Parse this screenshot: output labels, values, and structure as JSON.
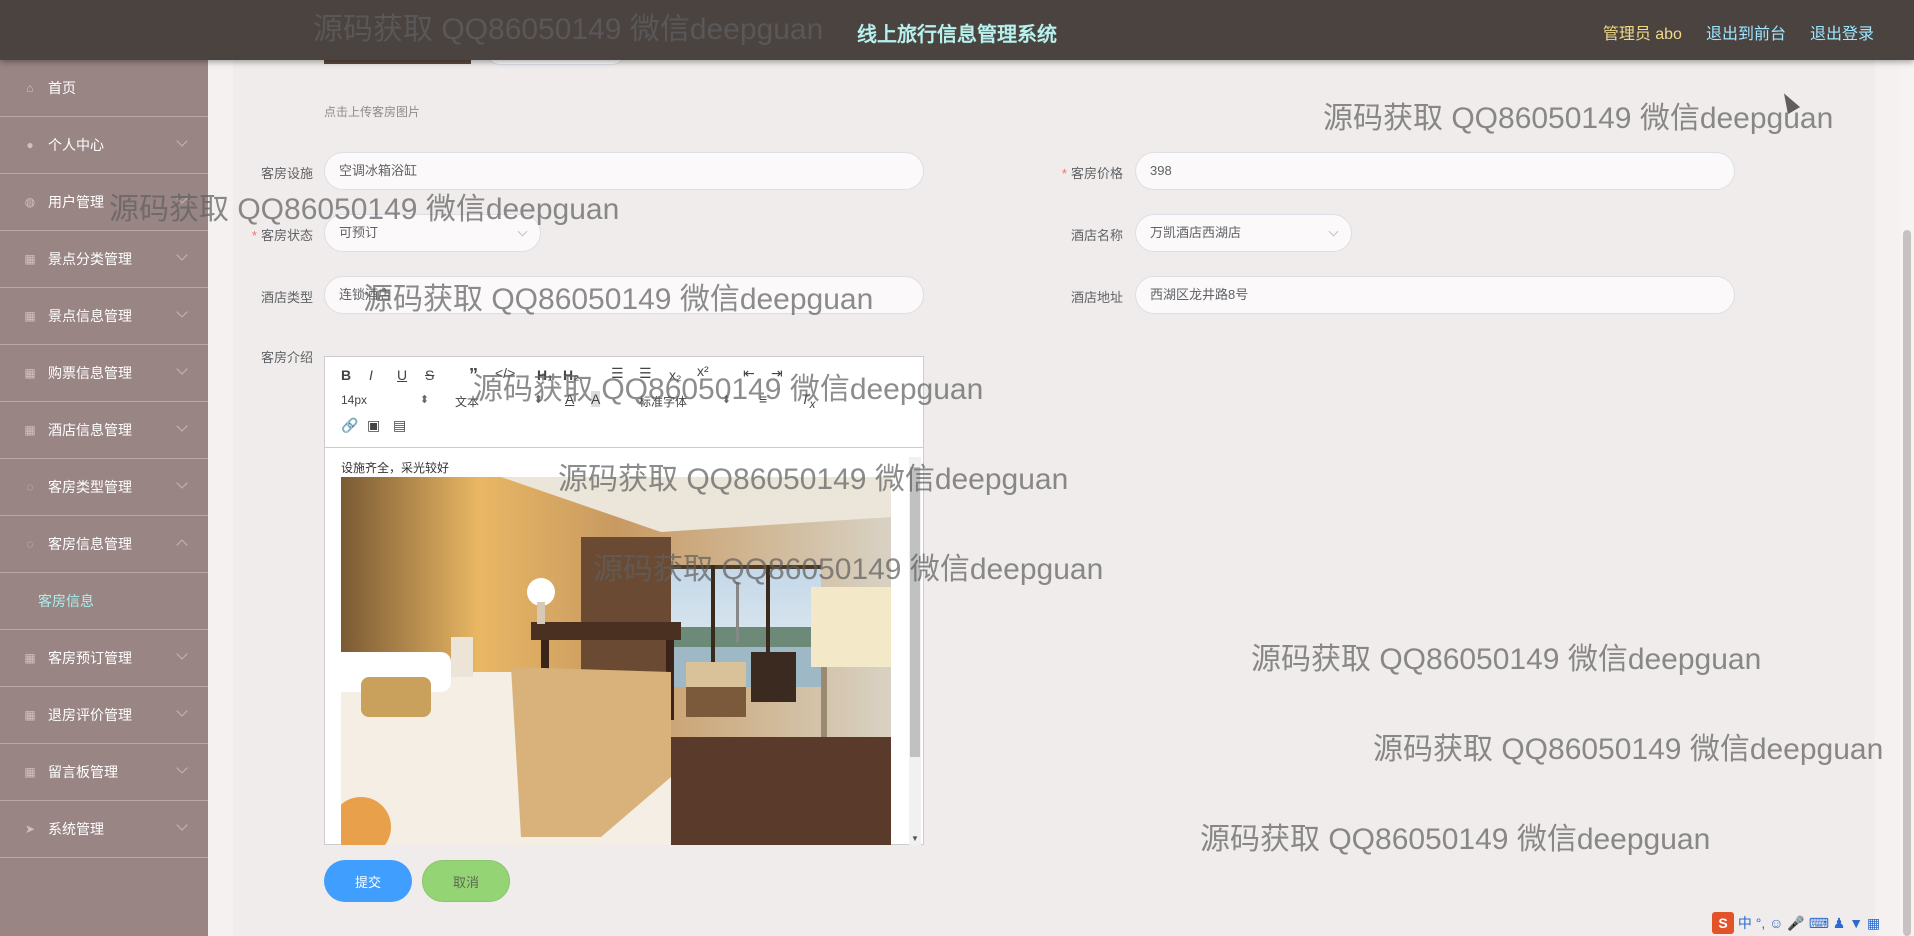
{
  "header": {
    "title": "线上旅行信息管理系统",
    "admin": "管理员 abo",
    "to_front": "退出到前台",
    "logout": "退出登录"
  },
  "sidebar": {
    "items": [
      {
        "label": "首页",
        "icon": "home-icon"
      },
      {
        "label": "个人中心",
        "icon": "user-icon"
      },
      {
        "label": "用户管理",
        "icon": "users-icon"
      },
      {
        "label": "景点分类管理",
        "icon": "grid-icon"
      },
      {
        "label": "景点信息管理",
        "icon": "grid-icon"
      },
      {
        "label": "购票信息管理",
        "icon": "grid-icon"
      },
      {
        "label": "酒店信息管理",
        "icon": "grid-icon"
      },
      {
        "label": "客房类型管理",
        "icon": "circle-icon"
      },
      {
        "label": "客房信息管理",
        "icon": "circle-icon"
      }
    ],
    "active_sub": "客房信息",
    "items_after": [
      {
        "label": "客房预订管理",
        "icon": "grid-icon"
      },
      {
        "label": "退房评价管理",
        "icon": "grid-icon"
      },
      {
        "label": "留言板管理",
        "icon": "grid-icon"
      },
      {
        "label": "系统管理",
        "icon": "send-icon"
      }
    ]
  },
  "form": {
    "upload_hint": "点击上传客房图片",
    "facility_label": "客房设施",
    "facility_value": "空调冰箱浴缸",
    "price_label": "客房价格",
    "price_value": "398",
    "status_label": "客房状态",
    "status_value": "可预订",
    "hotel_name_label": "酒店名称",
    "hotel_name_value": "万凯酒店西湖店",
    "hotel_type_label": "酒店类型",
    "hotel_type_value": "连锁酒店",
    "hotel_address_label": "酒店地址",
    "hotel_address_value": "西湖区龙井路8号",
    "intro_label": "客房介绍",
    "editor_text": "设施齐全，采光较好",
    "font_size": "14px",
    "text_format": "文本",
    "font_family": "标准字体",
    "submit": "提交",
    "cancel": "取消"
  },
  "watermark": "源码获取 QQ86050149 微信deepguan",
  "tray": "中",
  "colors": {
    "header_bg": "#4a4340",
    "sidebar_bg": "#9a8585",
    "title": "#b7f0ec",
    "primary": "#409eff",
    "cancel": "#95d475"
  }
}
